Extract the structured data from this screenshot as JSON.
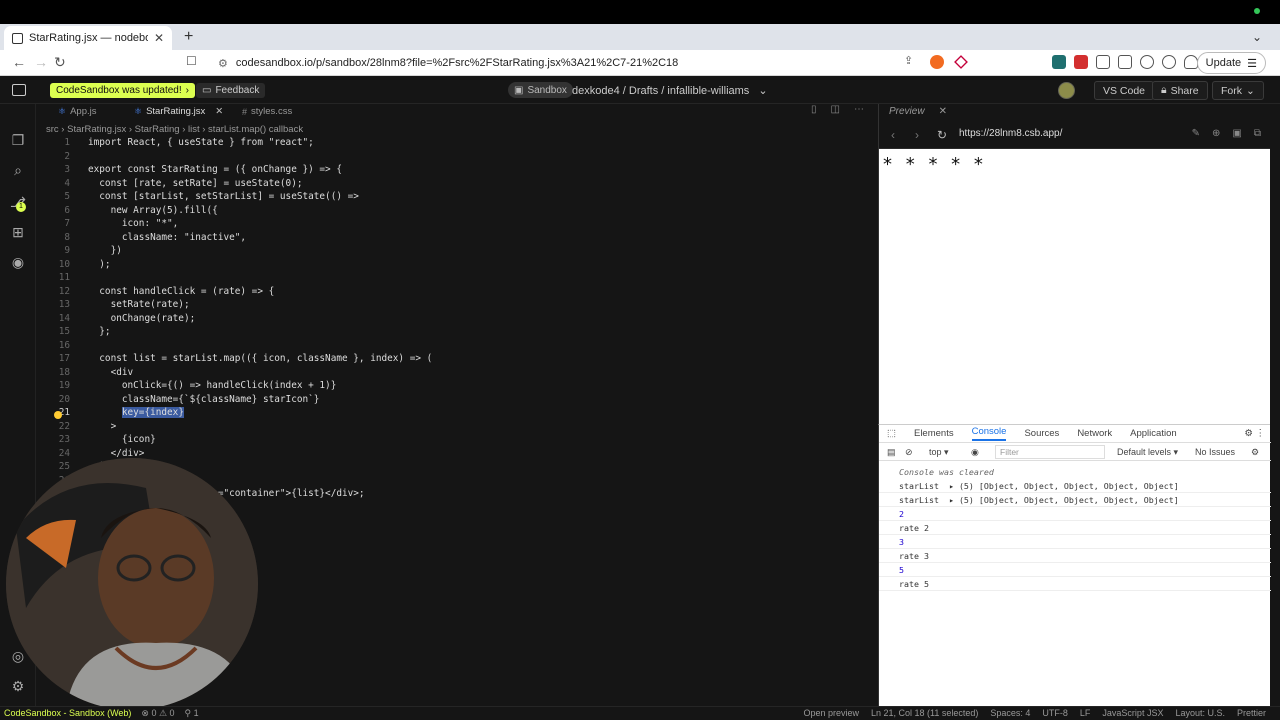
{
  "browser": {
    "tab_title": "StarRating.jsx — nodebox — C",
    "url": "codesandbox.io/p/sandbox/28lnm8?file=%2Fsrc%2FStarRating.jsx%3A21%2C7-21%2C18",
    "update_label": "Update"
  },
  "header": {
    "updated_label": "CodeSandbox was updated!",
    "feedback_label": "Feedback",
    "sandbox_label": "Sandbox",
    "breadcrumb": "dexkode4 / Drafts / infallible-williams",
    "vscode_label": "VS Code",
    "share_label": "Share",
    "fork_label": "Fork"
  },
  "activity_badge": "1",
  "editor": {
    "tabs": [
      "App.js",
      "StarRating.jsx",
      "styles.css"
    ],
    "breadcrumb": "src  ›  StarRating.jsx  ›  StarRating  ›  list  ›  starList.map() callback",
    "lines": [
      {
        "n": "1",
        "t": "import React, { useState } from \"react\";"
      },
      {
        "n": "2",
        "t": ""
      },
      {
        "n": "3",
        "t": "export const StarRating = ({ onChange }) => {"
      },
      {
        "n": "4",
        "t": "  const [rate, setRate] = useState(0);"
      },
      {
        "n": "5",
        "t": "  const [starList, setStarList] = useState(() =>"
      },
      {
        "n": "6",
        "t": "    new Array(5).fill({"
      },
      {
        "n": "7",
        "t": "      icon: \"*\","
      },
      {
        "n": "8",
        "t": "      className: \"inactive\","
      },
      {
        "n": "9",
        "t": "    })"
      },
      {
        "n": "10",
        "t": "  );"
      },
      {
        "n": "11",
        "t": ""
      },
      {
        "n": "12",
        "t": "  const handleClick = (rate) => {"
      },
      {
        "n": "13",
        "t": "    setRate(rate);"
      },
      {
        "n": "14",
        "t": "    onChange(rate);"
      },
      {
        "n": "15",
        "t": "  };"
      },
      {
        "n": "16",
        "t": ""
      },
      {
        "n": "17",
        "t": "  const list = starList.map(({ icon, className }, index) => ("
      },
      {
        "n": "18",
        "t": "    <div"
      },
      {
        "n": "19",
        "t": "      onClick={() => handleClick(index + 1)}"
      },
      {
        "n": "20",
        "t": "      className={`${className} starIcon`}"
      },
      {
        "n": "21",
        "t": ""
      },
      {
        "n": "22",
        "t": "    >"
      },
      {
        "n": "23",
        "t": "      {icon}"
      },
      {
        "n": "24",
        "t": "    </div>"
      },
      {
        "n": "25",
        "t": "  ));"
      },
      {
        "n": "26",
        "t": ""
      },
      {
        "n": "27",
        "t": "  return <div className=\"container\">{list}</div>;"
      }
    ],
    "selected_text": "key={index}"
  },
  "preview": {
    "label": "Preview",
    "url": "https://28lnm8.csb.app/",
    "stars": "* * * * *"
  },
  "devtools": {
    "tabs": [
      "Elements",
      "Console",
      "Sources",
      "Network",
      "Application"
    ],
    "context": "top",
    "filter_placeholder": "Filter",
    "levels": "Default levels",
    "issues": "No Issues",
    "console": [
      {
        "text": "Console was cleared",
        "kind": "italic"
      },
      {
        "text": "starList  ▸ (5) [Object, Object, Object, Object, Object]",
        "kind": ""
      },
      {
        "text": "starList  ▸ (5) [Object, Object, Object, Object, Object]",
        "kind": ""
      },
      {
        "text": "2",
        "kind": "num"
      },
      {
        "text": "rate 2",
        "kind": ""
      },
      {
        "text": "3",
        "kind": "num"
      },
      {
        "text": "rate 3",
        "kind": ""
      },
      {
        "text": "5",
        "kind": "num"
      },
      {
        "text": "rate 5",
        "kind": ""
      }
    ]
  },
  "status": {
    "brand": "CodeSandbox - Sandbox (Web)",
    "errors": "⊗ 0 ⚠ 0",
    "ports": "⚲ 1",
    "open_preview": "Open preview",
    "position": "Ln 21, Col 18 (11 selected)",
    "spaces": "Spaces: 4",
    "encoding": "UTF-8",
    "eol": "LF",
    "language": "JavaScript JSX",
    "layout": "Layout: U.S.",
    "formatter": "Prettier"
  }
}
